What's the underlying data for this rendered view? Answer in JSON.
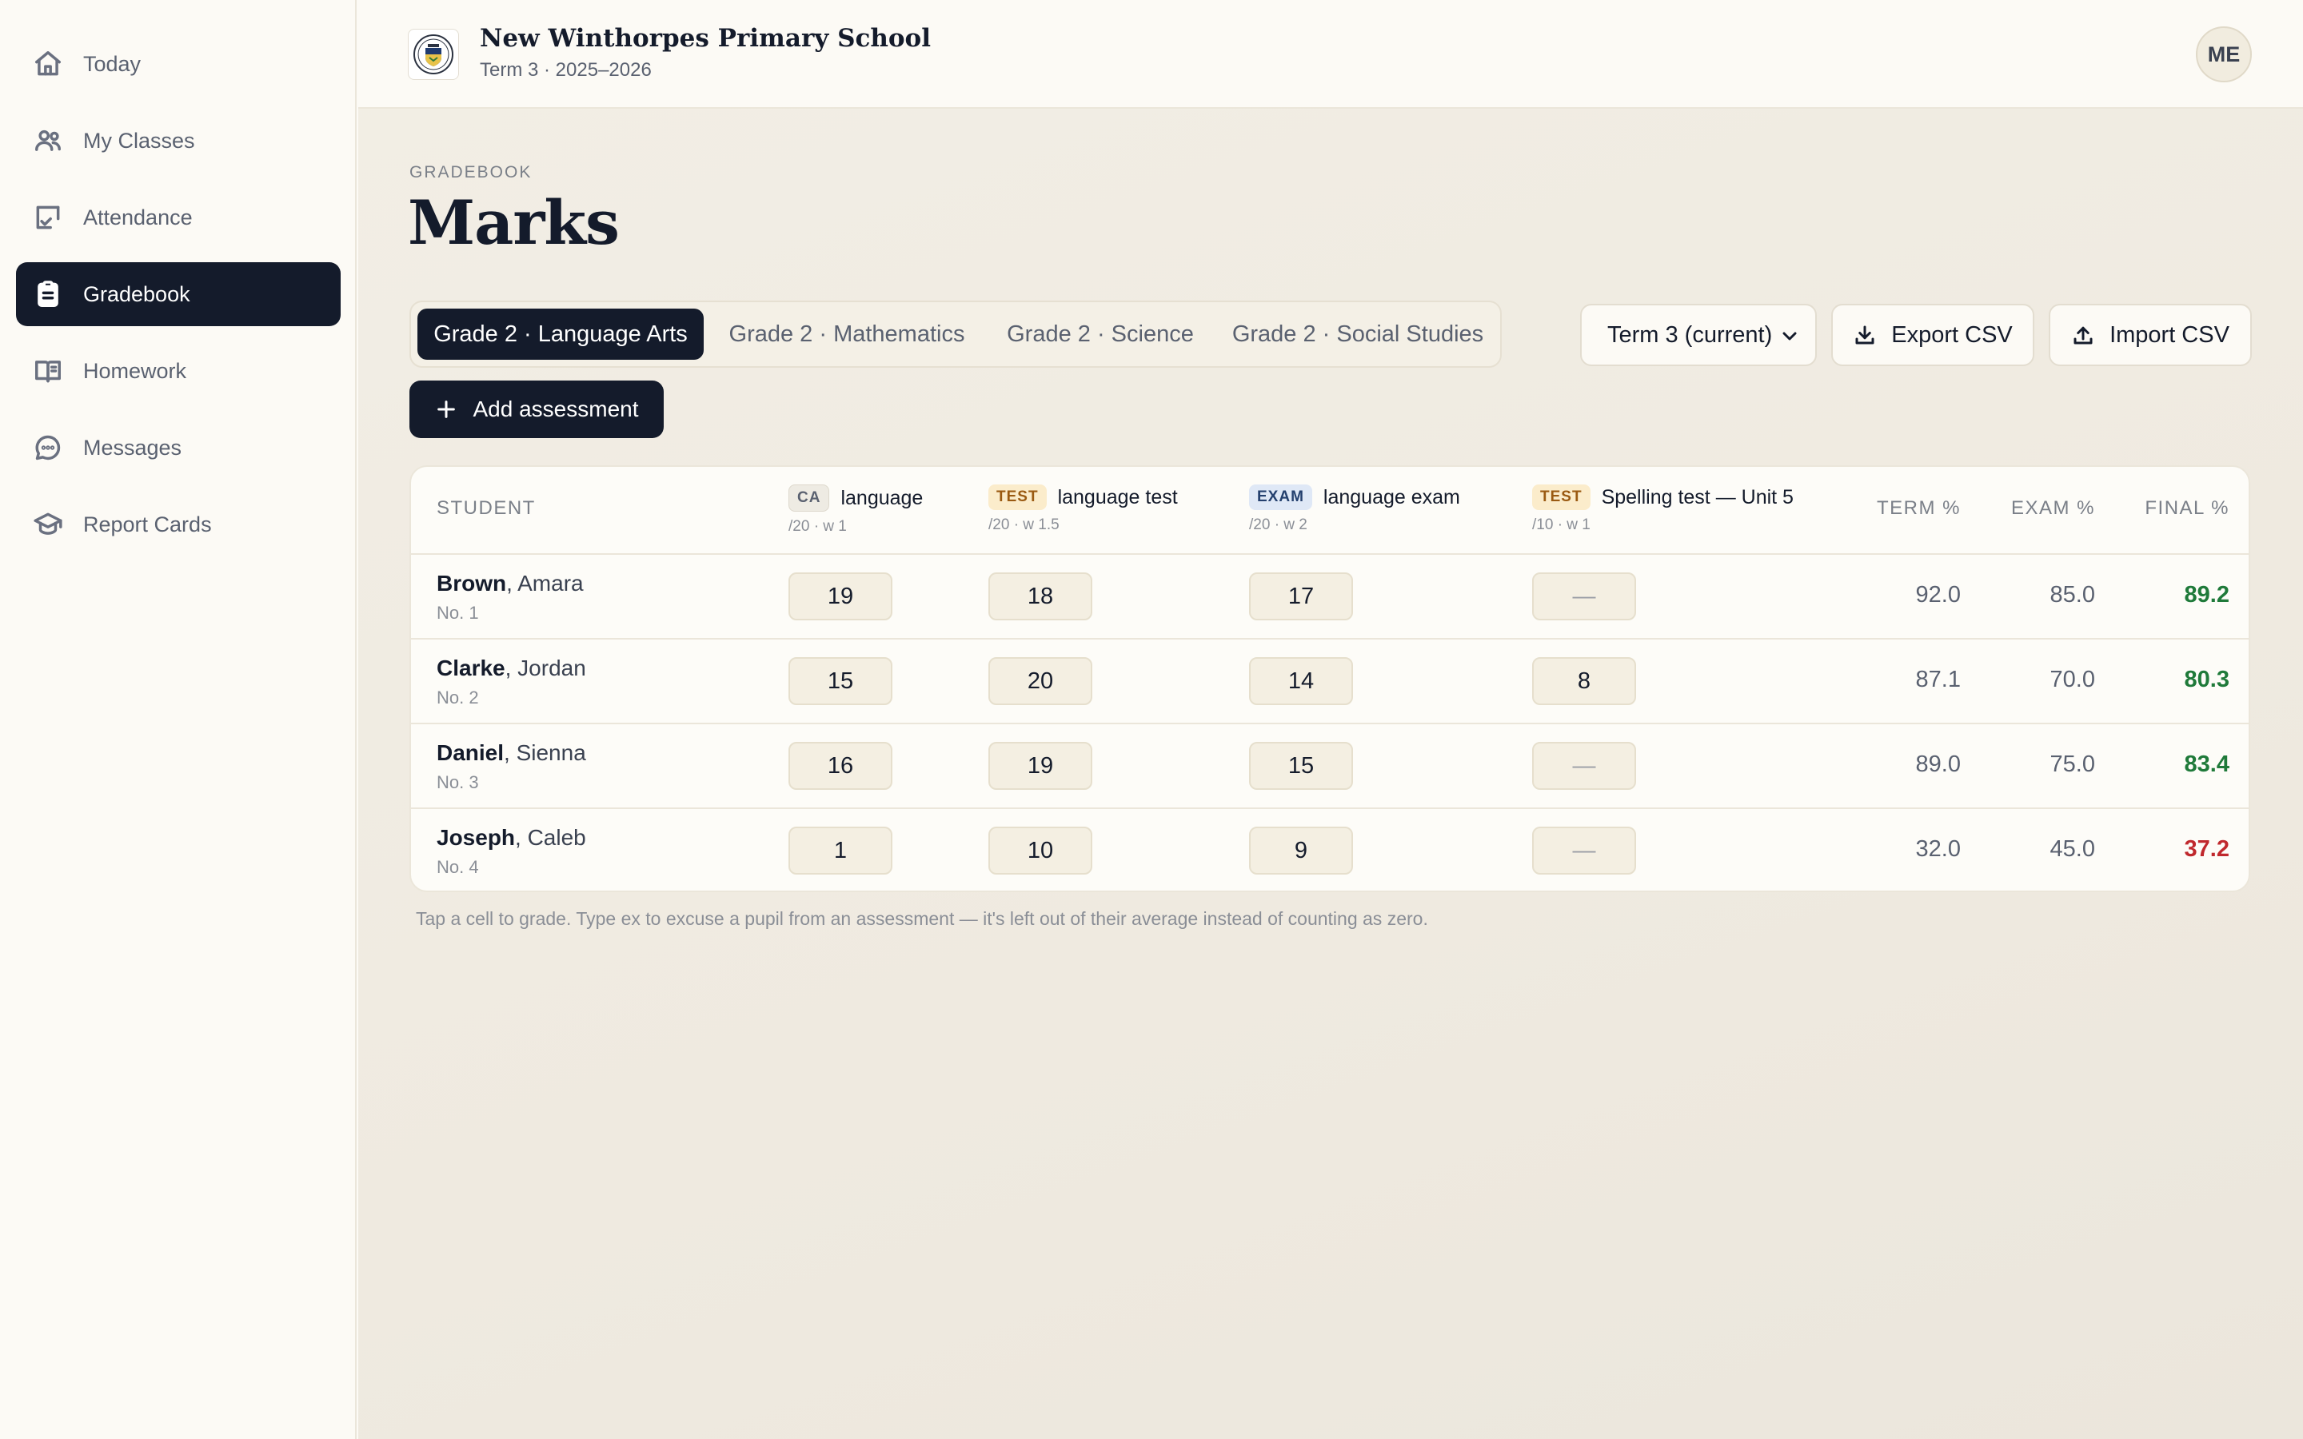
{
  "sidebar": {
    "items": [
      {
        "label": "Today",
        "icon": "home-icon"
      },
      {
        "label": "My Classes",
        "icon": "users-icon"
      },
      {
        "label": "Attendance",
        "icon": "attendance-icon"
      },
      {
        "label": "Gradebook",
        "icon": "clipboard-icon",
        "active": true
      },
      {
        "label": "Homework",
        "icon": "book-icon"
      },
      {
        "label": "Messages",
        "icon": "chat-icon"
      },
      {
        "label": "Report Cards",
        "icon": "graduation-cap-icon"
      }
    ]
  },
  "header": {
    "school_name": "New Winthorpes Primary School",
    "term_line": "Term 3 · 2025–2026",
    "avatar_initials": "ME"
  },
  "page": {
    "eyebrow": "GRADEBOOK",
    "title": "Marks"
  },
  "tabs": [
    {
      "label": "Grade 2 · Language Arts",
      "active": true
    },
    {
      "label": "Grade 2 · Mathematics"
    },
    {
      "label": "Grade 2 · Science"
    },
    {
      "label": "Grade 2 · Social Studies"
    }
  ],
  "toolbar": {
    "term_select": "Term 3 (current)",
    "export_label": "Export CSV",
    "import_label": "Import CSV",
    "add_label": "Add assessment"
  },
  "table": {
    "student_header": "STUDENT",
    "assessments": [
      {
        "type": "CA",
        "name": "language",
        "meta": "/20 · w 1"
      },
      {
        "type": "TEST",
        "name": "language test",
        "meta": "/20 · w 1.5"
      },
      {
        "type": "EXAM",
        "name": "language exam",
        "meta": "/20 · w 2"
      },
      {
        "type": "TEST",
        "name": "Spelling test — Unit 5",
        "meta": "/10 · w 1"
      }
    ],
    "summary_headers": [
      "TERM %",
      "EXAM %",
      "FINAL %"
    ],
    "rows": [
      {
        "last": "Brown",
        "first": ", Amara",
        "no": "No. 1",
        "marks": [
          "19",
          "18",
          "17",
          "—"
        ],
        "term": "92.0",
        "exam": "85.0",
        "final": "89.2",
        "final_status": "pass"
      },
      {
        "last": "Clarke",
        "first": ", Jordan",
        "no": "No. 2",
        "marks": [
          "15",
          "20",
          "14",
          "8"
        ],
        "term": "87.1",
        "exam": "70.0",
        "final": "80.3",
        "final_status": "pass"
      },
      {
        "last": "Daniel",
        "first": ", Sienna",
        "no": "No. 3",
        "marks": [
          "16",
          "19",
          "15",
          "—"
        ],
        "term": "89.0",
        "exam": "75.0",
        "final": "83.4",
        "final_status": "pass"
      },
      {
        "last": "Joseph",
        "first": ", Caleb",
        "no": "No. 4",
        "marks": [
          "1",
          "10",
          "9",
          "—"
        ],
        "term": "32.0",
        "exam": "45.0",
        "final": "37.2",
        "final_status": "fail"
      }
    ]
  },
  "footnote": "Tap a cell to grade. Type ex to excuse a pupil from an assessment — it's left out of their average instead of counting as zero.",
  "colors": {
    "accent": "#141b2b",
    "pass": "#1f7a3a",
    "fail": "#c0282d"
  }
}
